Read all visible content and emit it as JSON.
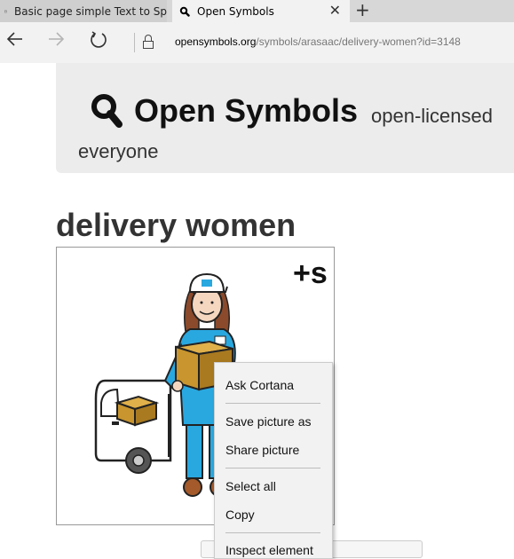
{
  "browser": {
    "tabs": [
      {
        "title": "Basic page simple Text to Sp",
        "active": false
      },
      {
        "title": "Open Symbols",
        "active": true
      }
    ],
    "close_glyph": "✕",
    "new_tab_glyph": "+",
    "url_host": "opensymbols.org",
    "url_path": "/symbols/arasaac/delivery-women?id=3148"
  },
  "header": {
    "site_name": "Open Symbols",
    "tagline_line1": "open-licensed",
    "tagline_line2": "everyone"
  },
  "symbol": {
    "title": "delivery women",
    "badge": "+s"
  },
  "context_menu": {
    "items": [
      "Ask Cortana",
      "Save picture as",
      "Share picture",
      "Select all",
      "Copy",
      "Inspect element"
    ]
  },
  "colors": {
    "tab_strip": "#d7d7d7",
    "header_bg": "#ececec",
    "uniform_blue": "#29a8e0",
    "box_brown": "#c8952e"
  }
}
